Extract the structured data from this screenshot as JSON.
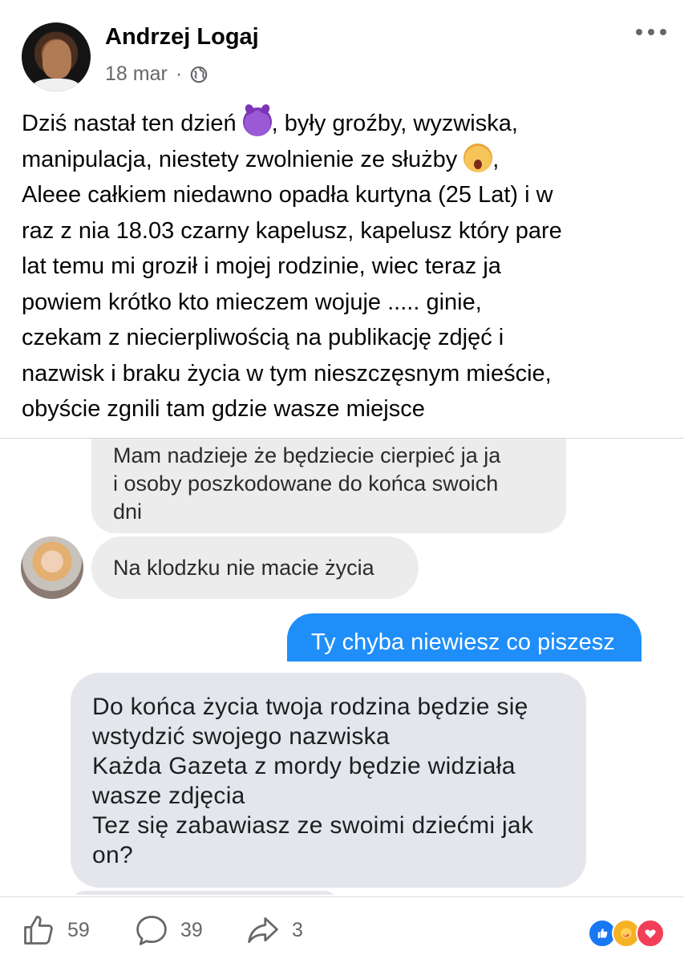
{
  "post": {
    "author": "Andrzej Logaj",
    "date": "18 mar",
    "separator": "·",
    "text_lines": [
      {
        "before": "Dziś nastał ten dzień ",
        "emoji": "smiling-imp",
        "after": ", były groźby, wyzwiska,"
      },
      {
        "before": "manipulacja, niestety zwolnienie ze służby ",
        "emoji": "weary-cat",
        "after": ","
      },
      {
        "before": "Aleee całkiem niedawno opadła kurtyna (25 Lat) i w"
      },
      {
        "before": "raz z nia 18.03 czarny kapelusz, kapelusz który pare"
      },
      {
        "before": "lat temu mi groził i mojej rodzinie, wiec teraz ja"
      },
      {
        "before": "powiem krótko kto mieczem wojuje ..... ginie,"
      },
      {
        "before": "czekam z niecierpliwością na publikację zdjęć i"
      },
      {
        "before": "nazwisk i braku życia w tym nieszczęsnym mieście,"
      },
      {
        "before": "obyście zgnili tam gdzie wasze miejsce"
      }
    ]
  },
  "screenshot1": {
    "message1_lines": [
      "Mam nadzieje że będziecie cierpieć ja ja",
      "i osoby poszkodowane do końca swoich",
      "dni"
    ],
    "message2": "Na klodzku nie macie życia",
    "reply": "Ty chyba niewiesz co piszesz"
  },
  "screenshot2": {
    "message_lines": [
      "Do końca życia twoja rodzina będzie się",
      "wstydzić swojego nazwiska",
      "Każda Gazeta z mordy będzie widziała",
      "wasze zdjęcia",
      "Tez się zabawiasz ze swoimi dziećmi jak",
      "on?"
    ]
  },
  "footer": {
    "likes": "59",
    "comments": "39",
    "shares": "3",
    "reactions": [
      "like",
      "care",
      "love"
    ],
    "colors": {
      "like": "#1877f2",
      "care": "#f7b125",
      "love": "#f33e58"
    }
  }
}
